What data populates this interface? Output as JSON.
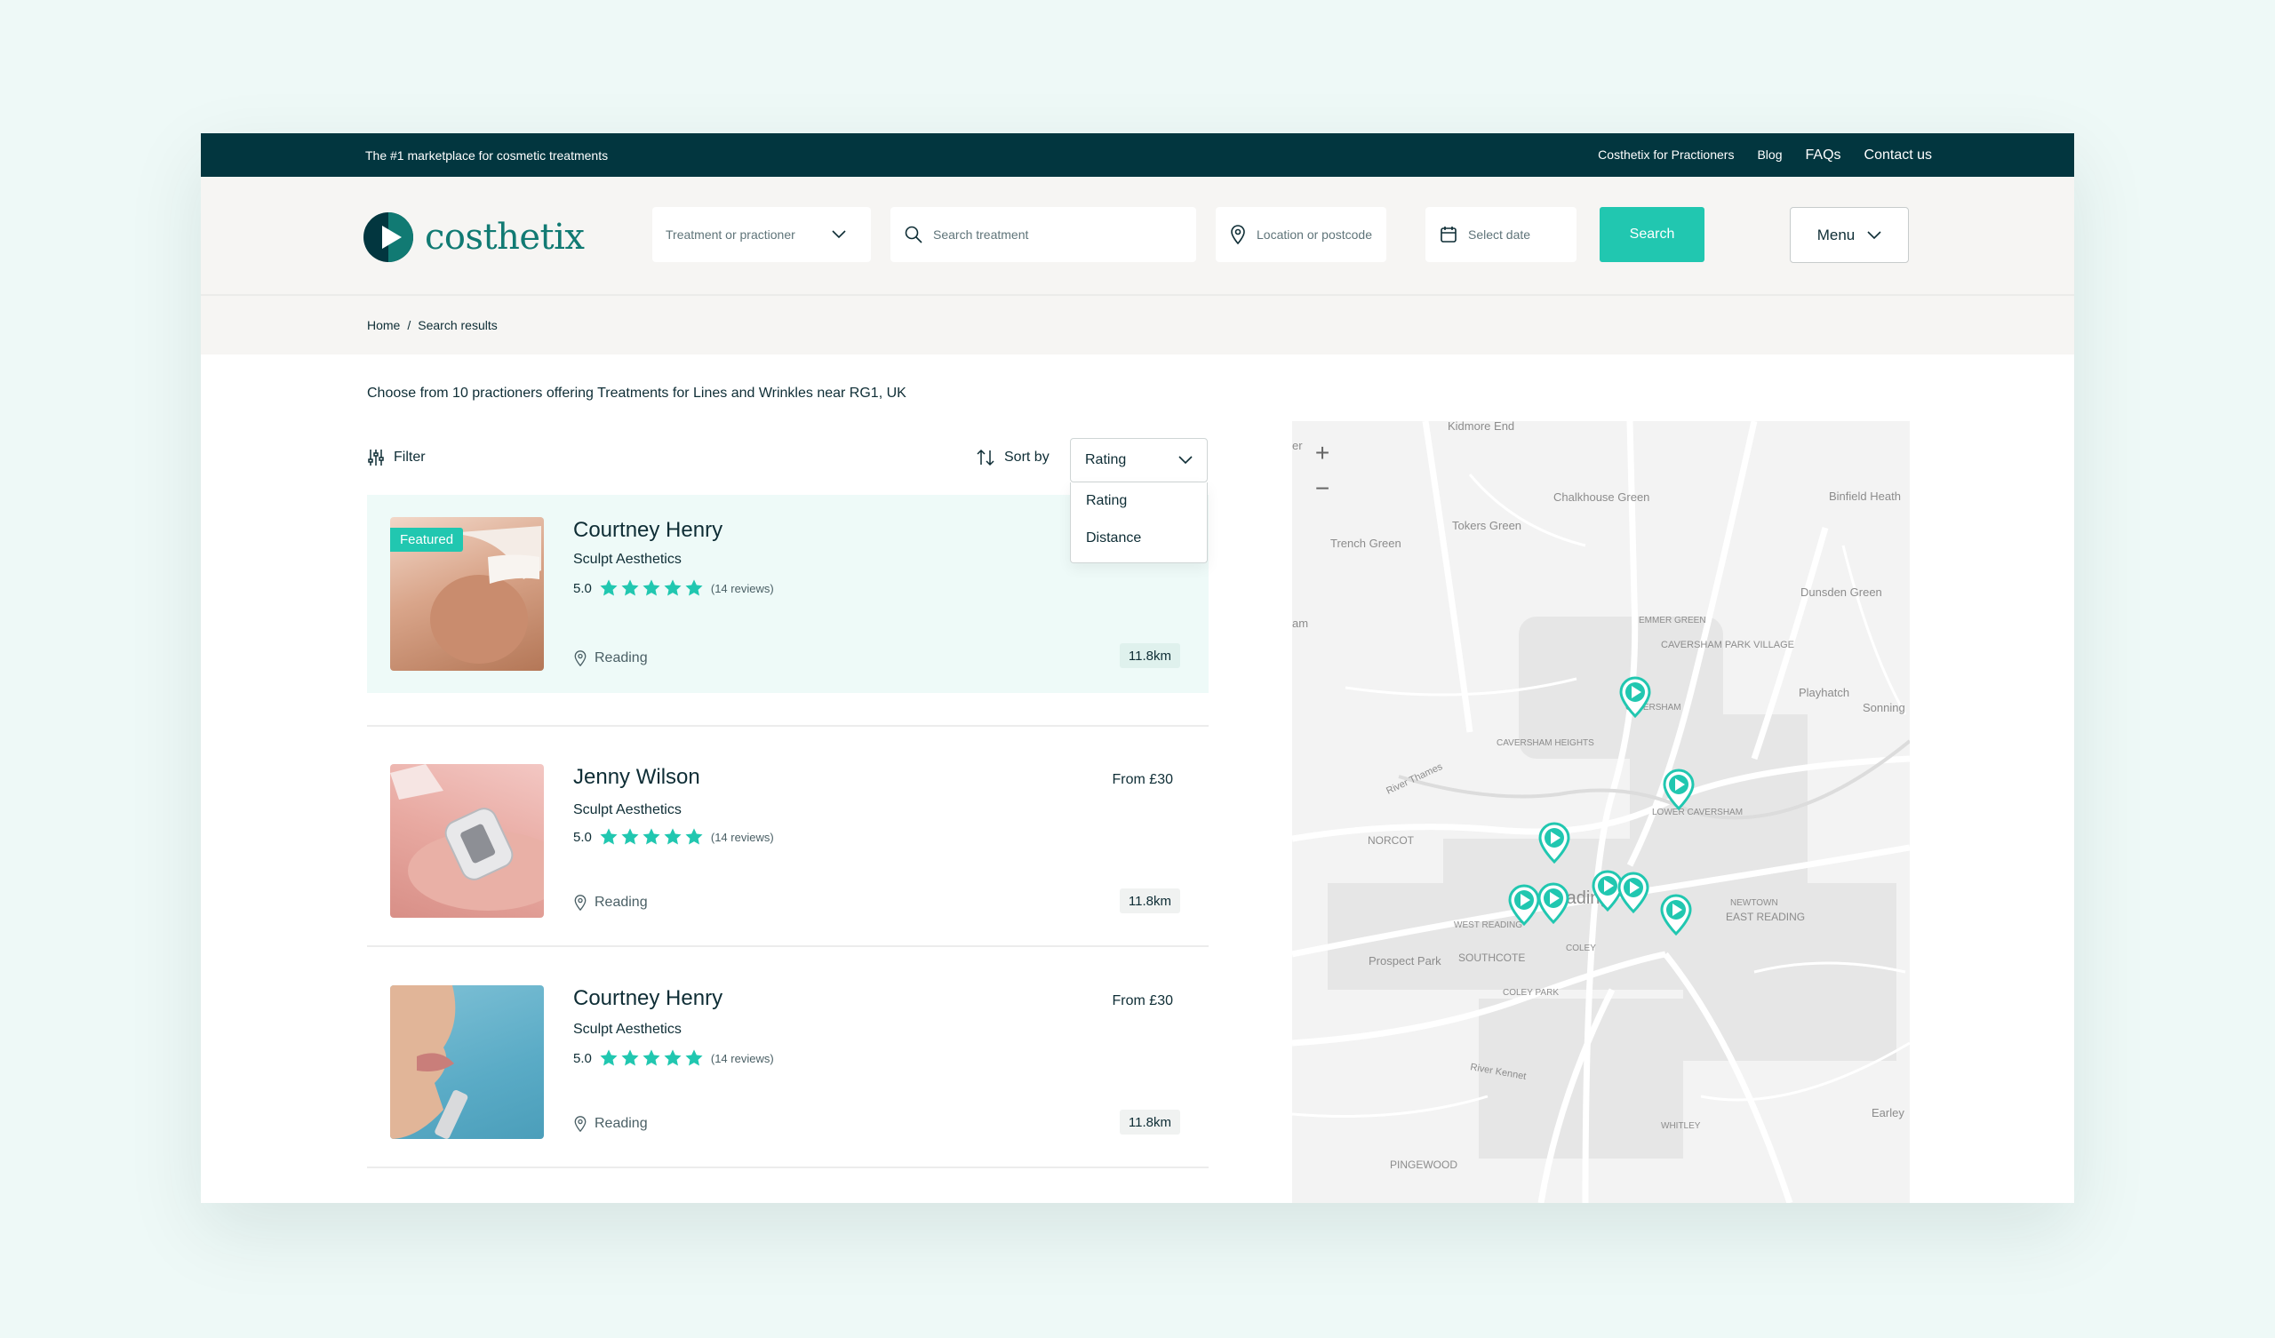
{
  "topbar": {
    "tagline": "The #1 marketplace for cosmetic treatments",
    "links": [
      "Costhetix for Practioners",
      "Blog",
      "FAQs",
      "Contact us"
    ]
  },
  "header": {
    "logo_text": "costhetix",
    "treatment_select": "Treatment or practioner",
    "search_placeholder": "Search treatment",
    "location_placeholder": "Location or postcode",
    "date_placeholder": "Select date",
    "search_button": "Search",
    "menu_button": "Menu"
  },
  "breadcrumb": {
    "home": "Home",
    "current": "Search results"
  },
  "results": {
    "intro": "Choose from 10 practioners offering Treatments for Lines and Wrinkles near RG1, UK",
    "filter_label": "Filter",
    "sort_label": "Sort by",
    "sort_value": "Rating",
    "sort_options": [
      "Rating",
      "Distance"
    ],
    "cards": [
      {
        "badge": "Featured",
        "name": "Courtney Henry",
        "clinic": "Sculpt Aesthetics",
        "rating": "5.0",
        "stars": 5,
        "reviews": "(14 reviews)",
        "location": "Reading",
        "distance": "11.8km",
        "price": ""
      },
      {
        "name": "Jenny Wilson",
        "clinic": "Sculpt Aesthetics",
        "rating": "5.0",
        "stars": 5,
        "reviews": "(14 reviews)",
        "location": "Reading",
        "distance": "11.8km",
        "price": "From £30"
      },
      {
        "name": "Courtney Henry",
        "clinic": "Sculpt Aesthetics",
        "rating": "5.0",
        "stars": 5,
        "reviews": "(14 reviews)",
        "location": "Reading",
        "distance": "11.8km",
        "price": "From £30"
      }
    ]
  },
  "map": {
    "zoom_in": "+",
    "zoom_out": "−",
    "labels": [
      "Kidmore End",
      "Chalkhouse Green",
      "Tokers Green",
      "Trench Green",
      "Binfield Heath",
      "Dunsden Green",
      "EMMER GREEN",
      "CAVERSHAM PARK VILLAGE",
      "CAVERSHAM",
      "Playhatch",
      "Sonning",
      "CAVERSHAM HEIGHTS",
      "LOWER CAVERSHAM",
      "NORCOT",
      "Reading",
      "WEST READING",
      "NEWTOWN",
      "EAST READING",
      "Prospect Park",
      "SOUTHCOTE",
      "COLEY",
      "COLEY PARK",
      "WHITLEY",
      "PINGEWOOD",
      "Earley",
      "River Kennet",
      "River Thames",
      "am",
      "er"
    ],
    "marker_color": "#21c7b0"
  },
  "colors": {
    "accent": "#21c7b0",
    "dark": "#02363f",
    "brand": "#117a73"
  }
}
